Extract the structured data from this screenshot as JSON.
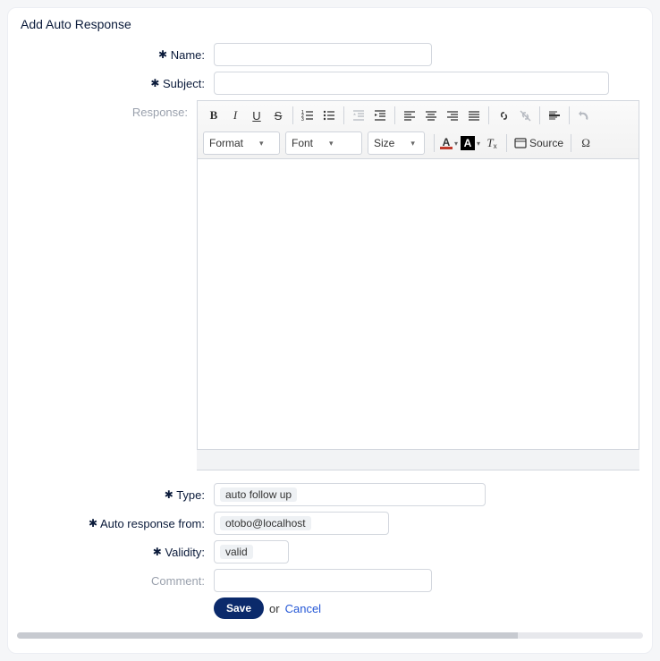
{
  "panelTitle": "Add Auto Response",
  "labels": {
    "name": "Name:",
    "subject": "Subject:",
    "response": "Response:",
    "type": "Type:",
    "from": "Auto response from:",
    "validity": "Validity:",
    "comment": "Comment:"
  },
  "fields": {
    "name": "",
    "subject": "",
    "type": "auto follow up",
    "from": "otobo@localhost",
    "validity": "valid",
    "comment": ""
  },
  "editor": {
    "toolbar": {
      "format": "Format",
      "font": "Font",
      "size": "Size",
      "source": "Source"
    }
  },
  "buttons": {
    "save": "Save",
    "or": "or",
    "cancel": "Cancel"
  }
}
